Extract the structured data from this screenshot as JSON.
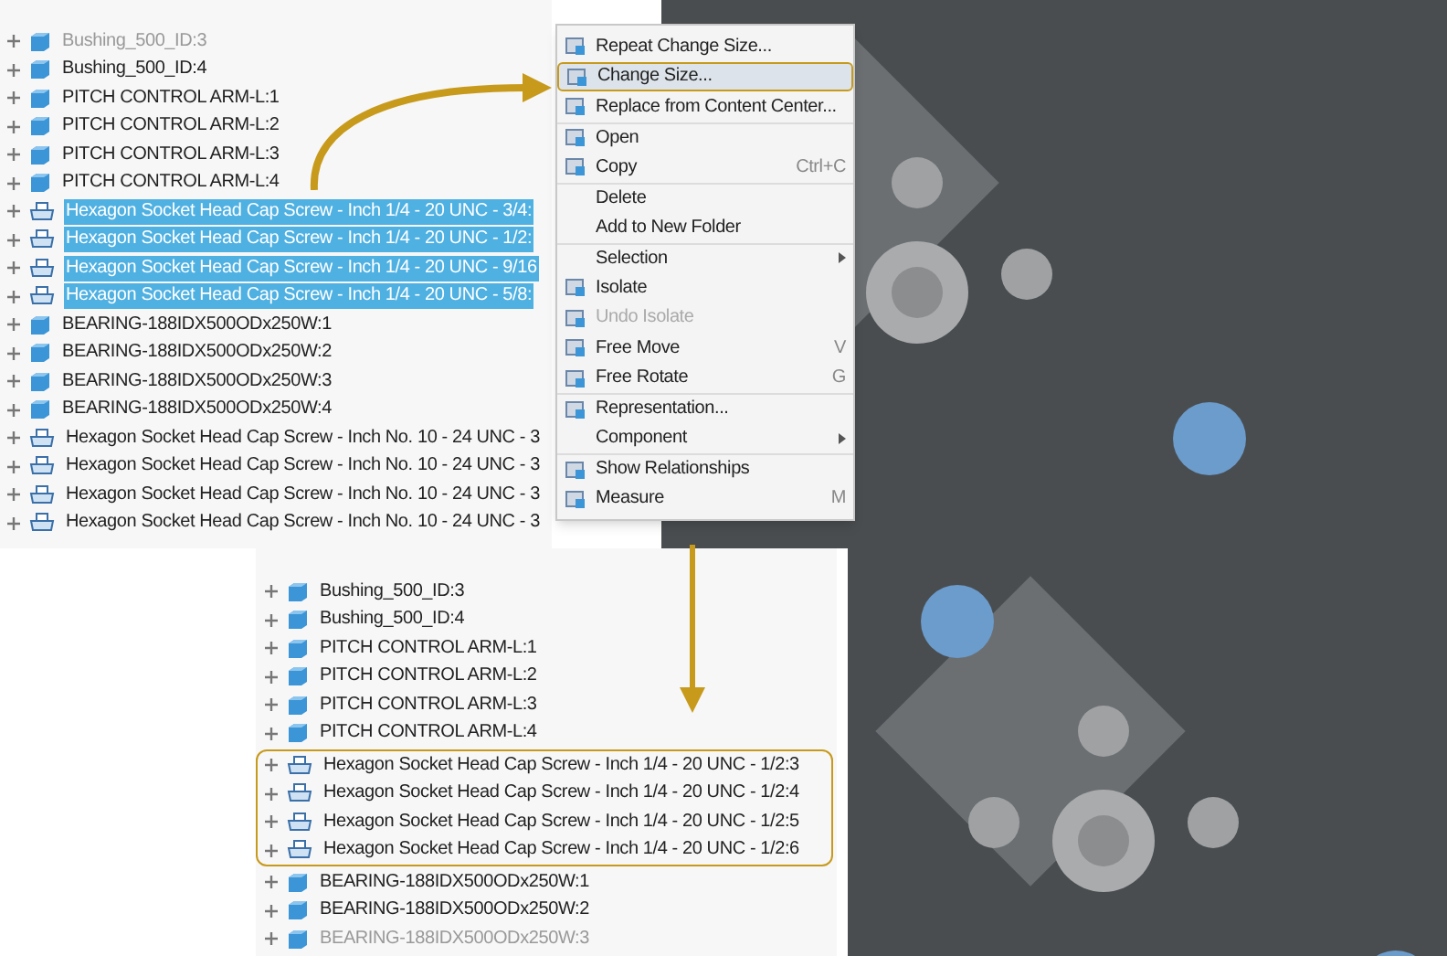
{
  "top_tree": {
    "rows": [
      {
        "kind": "part",
        "label": "Bushing_500_ID:3",
        "selected": false,
        "faded": true
      },
      {
        "kind": "part",
        "label": "Bushing_500_ID:4",
        "selected": false,
        "faded": false
      },
      {
        "kind": "part",
        "label": "PITCH CONTROL ARM-L:1",
        "selected": false,
        "faded": false
      },
      {
        "kind": "part",
        "label": "PITCH CONTROL ARM-L:2",
        "selected": false,
        "faded": false
      },
      {
        "kind": "part",
        "label": "PITCH CONTROL ARM-L:3",
        "selected": false,
        "faded": false
      },
      {
        "kind": "part",
        "label": "PITCH CONTROL ARM-L:4",
        "selected": false,
        "faded": false
      },
      {
        "kind": "screw",
        "label": "Hexagon Socket Head Cap Screw - Inch 1/4 - 20 UNC - 3/4:",
        "selected": true,
        "faded": false
      },
      {
        "kind": "screw",
        "label": "Hexagon Socket Head Cap Screw - Inch 1/4 - 20 UNC - 1/2:",
        "selected": true,
        "faded": false
      },
      {
        "kind": "screw",
        "label": "Hexagon Socket Head Cap Screw - Inch 1/4 - 20 UNC - 9/16",
        "selected": true,
        "faded": false
      },
      {
        "kind": "screw",
        "label": "Hexagon Socket Head Cap Screw - Inch 1/4 - 20 UNC - 5/8:",
        "selected": true,
        "faded": false
      },
      {
        "kind": "part",
        "label": "BEARING-188IDX500ODx250W:1",
        "selected": false,
        "faded": false
      },
      {
        "kind": "part",
        "label": "BEARING-188IDX500ODx250W:2",
        "selected": false,
        "faded": false
      },
      {
        "kind": "part",
        "label": "BEARING-188IDX500ODx250W:3",
        "selected": false,
        "faded": false
      },
      {
        "kind": "part",
        "label": "BEARING-188IDX500ODx250W:4",
        "selected": false,
        "faded": false
      },
      {
        "kind": "screw",
        "label": "Hexagon Socket Head Cap Screw - Inch No. 10 - 24 UNC - 3",
        "selected": false,
        "faded": false
      },
      {
        "kind": "screw",
        "label": "Hexagon Socket Head Cap Screw - Inch No. 10 - 24 UNC - 3",
        "selected": false,
        "faded": false
      },
      {
        "kind": "screw",
        "label": "Hexagon Socket Head Cap Screw - Inch No. 10 - 24 UNC - 3",
        "selected": false,
        "faded": false
      },
      {
        "kind": "screw",
        "label": "Hexagon Socket Head Cap Screw - Inch No. 10 - 24 UNC - 3",
        "selected": false,
        "faded": false
      }
    ]
  },
  "context_menu": {
    "items": [
      {
        "label": "Repeat Change Size...",
        "icon": true,
        "disabled": false,
        "highlighted": false,
        "separator_before": false
      },
      {
        "label": "Change Size...",
        "icon": true,
        "disabled": false,
        "highlighted": true,
        "separator_before": false
      },
      {
        "label": "Replace from Content Center...",
        "icon": true,
        "disabled": false,
        "highlighted": false,
        "separator_before": false
      },
      {
        "label": "Open",
        "icon": true,
        "disabled": false,
        "highlighted": false,
        "separator_before": true
      },
      {
        "label": "Copy",
        "shortcut": "Ctrl+C",
        "icon": true,
        "disabled": false,
        "highlighted": false,
        "separator_before": false
      },
      {
        "label": "Delete",
        "icon": false,
        "disabled": false,
        "highlighted": false,
        "separator_before": true
      },
      {
        "label": "Add to New Folder",
        "icon": false,
        "disabled": false,
        "highlighted": false,
        "separator_before": false
      },
      {
        "label": "Selection",
        "submenu": true,
        "icon": false,
        "disabled": false,
        "highlighted": false,
        "separator_before": true
      },
      {
        "label": "Isolate",
        "icon": true,
        "disabled": false,
        "highlighted": false,
        "separator_before": false
      },
      {
        "label": "Undo Isolate",
        "icon": true,
        "disabled": true,
        "highlighted": false,
        "separator_before": false
      },
      {
        "label": "Free Move",
        "shortcut": "V",
        "icon": true,
        "disabled": false,
        "highlighted": false,
        "separator_before": false
      },
      {
        "label": "Free Rotate",
        "shortcut": "G",
        "icon": true,
        "disabled": false,
        "highlighted": false,
        "separator_before": false
      },
      {
        "label": "Representation...",
        "icon": true,
        "disabled": false,
        "highlighted": false,
        "separator_before": true
      },
      {
        "label": "Component",
        "submenu": true,
        "icon": false,
        "disabled": false,
        "highlighted": false,
        "separator_before": false
      },
      {
        "label": "Show Relationships",
        "icon": true,
        "disabled": false,
        "highlighted": false,
        "separator_before": true
      },
      {
        "label": "Measure",
        "shortcut": "M",
        "icon": true,
        "disabled": false,
        "highlighted": false,
        "separator_before": false
      }
    ]
  },
  "bottom_tree": {
    "groups": [
      {
        "outlined": false,
        "rows": [
          {
            "kind": "part",
            "label": "Bushing_500_ID:3",
            "faded": false
          },
          {
            "kind": "part",
            "label": "Bushing_500_ID:4",
            "faded": false
          },
          {
            "kind": "part",
            "label": "PITCH CONTROL ARM-L:1",
            "faded": false
          },
          {
            "kind": "part",
            "label": "PITCH CONTROL ARM-L:2",
            "faded": false
          },
          {
            "kind": "part",
            "label": "PITCH CONTROL ARM-L:3",
            "faded": false
          },
          {
            "kind": "part",
            "label": "PITCH CONTROL ARM-L:4",
            "faded": false
          }
        ]
      },
      {
        "outlined": true,
        "rows": [
          {
            "kind": "screw",
            "label": "Hexagon Socket Head Cap Screw - Inch 1/4 - 20 UNC - 1/2:3",
            "faded": false
          },
          {
            "kind": "screw",
            "label": "Hexagon Socket Head Cap Screw - Inch 1/4 - 20 UNC - 1/2:4",
            "faded": false
          },
          {
            "kind": "screw",
            "label": "Hexagon Socket Head Cap Screw - Inch 1/4 - 20 UNC - 1/2:5",
            "faded": false
          },
          {
            "kind": "screw",
            "label": "Hexagon Socket Head Cap Screw - Inch 1/4 - 20 UNC - 1/2:6",
            "faded": false
          }
        ]
      },
      {
        "outlined": false,
        "rows": [
          {
            "kind": "part",
            "label": "BEARING-188IDX500ODx250W:1",
            "faded": false
          },
          {
            "kind": "part",
            "label": "BEARING-188IDX500ODx250W:2",
            "faded": false
          },
          {
            "kind": "part",
            "label": "BEARING-188IDX500ODx250W:3",
            "faded": true
          }
        ]
      }
    ]
  }
}
